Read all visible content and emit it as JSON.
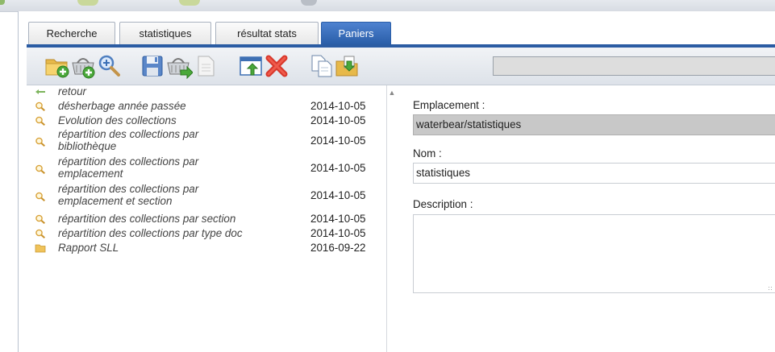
{
  "tabs": [
    {
      "label": "Recherche",
      "active": false
    },
    {
      "label": "statistiques",
      "active": false
    },
    {
      "label": "résultat stats",
      "active": false
    },
    {
      "label": "Paniers",
      "active": true
    }
  ],
  "toolbar": {
    "icons": [
      "folder-add-icon",
      "basket-add-icon",
      "magnifier-icon",
      "save-icon",
      "basket-export-icon",
      "blank-document-icon",
      "window-export-icon",
      "delete-icon",
      "copy-icon",
      "folder-paste-icon"
    ],
    "path_value": ""
  },
  "list": {
    "items": [
      {
        "icon": "back-arrow-icon",
        "name": "retour",
        "date": ""
      },
      {
        "icon": "magnifier-icon",
        "name": "désherbage année passée",
        "date": "2014-10-05"
      },
      {
        "icon": "magnifier-icon",
        "name": "Evolution des collections",
        "date": "2014-10-05"
      },
      {
        "icon": "magnifier-icon",
        "name_lines": [
          "répartition des collections par",
          "bibliothèque"
        ],
        "date": "2014-10-05"
      },
      {
        "icon": "magnifier-icon",
        "name_lines": [
          "répartition des collections par",
          "emplacement"
        ],
        "date": "2014-10-05"
      },
      {
        "icon": "magnifier-icon",
        "name_lines": [
          "répartition des collections par",
          "emplacement et section"
        ],
        "date": "2014-10-05"
      },
      {
        "icon": "magnifier-icon",
        "name": "répartition des collections par section",
        "date": "2014-10-05"
      },
      {
        "icon": "magnifier-icon",
        "name": "répartition des collections par type doc",
        "date": "2014-10-05"
      },
      {
        "icon": "folder-icon",
        "name": "Rapport SLL",
        "date": "2016-09-22"
      }
    ]
  },
  "form": {
    "emplacement_label": "Emplacement :",
    "emplacement_value": "waterbear/statistiques",
    "nom_label": "Nom :",
    "nom_value": "statistiques",
    "description_label": "Description :",
    "description_value": ""
  },
  "colors": {
    "tab_active": "#2a5ea8",
    "tab_underline": "#2b5ca3",
    "readonly_field": "#c8c8c8"
  }
}
